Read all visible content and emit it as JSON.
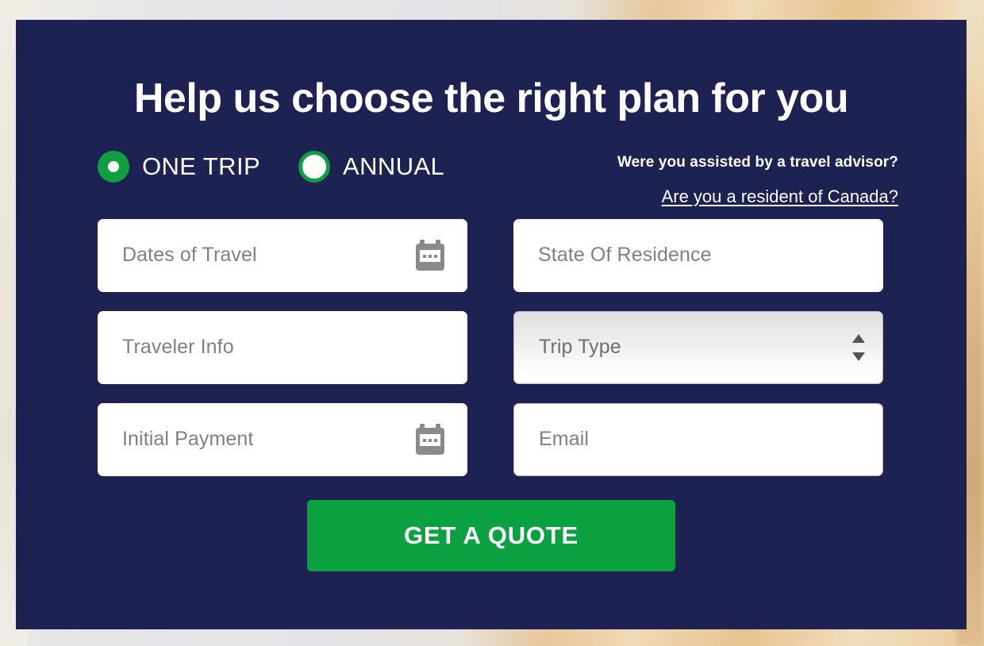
{
  "theme": {
    "panel_bg": "#1e2253",
    "accent_green": "#119e41",
    "cta_green": "#0ba141",
    "field_bg": "#ffffff",
    "placeholder_color": "#808084",
    "text_on_panel": "#ffffff"
  },
  "form": {
    "heading": "Help us choose the right plan for you",
    "plan_options": [
      {
        "label": "ONE TRIP",
        "selected": true
      },
      {
        "label": "ANNUAL",
        "selected": false
      }
    ],
    "advisor_question": "Were you assisted by a travel advisor?",
    "resident_link": "Are you a resident of Canada?",
    "fields": [
      {
        "name": "dates-of-travel",
        "placeholder": "Dates of Travel",
        "value": "",
        "type": "text",
        "icon": "calendar-icon",
        "bordered": false
      },
      {
        "name": "state-of-residence",
        "placeholder": "State Of Residence",
        "value": "",
        "type": "text",
        "icon": "",
        "bordered": false
      },
      {
        "name": "traveler-info",
        "placeholder": "Traveler Info",
        "value": "",
        "type": "text",
        "icon": "",
        "bordered": false
      },
      {
        "name": "trip-type",
        "placeholder": "Trip Type",
        "value": "",
        "type": "select",
        "icon": "updown-spinner-icon",
        "bordered": true
      },
      {
        "name": "initial-payment",
        "placeholder": "Initial Payment",
        "value": "",
        "type": "text",
        "icon": "calendar-icon",
        "bordered": false
      },
      {
        "name": "email",
        "placeholder": "Email",
        "value": "",
        "type": "text",
        "icon": "",
        "bordered": true
      }
    ],
    "submit_label": "GET A QUOTE"
  }
}
